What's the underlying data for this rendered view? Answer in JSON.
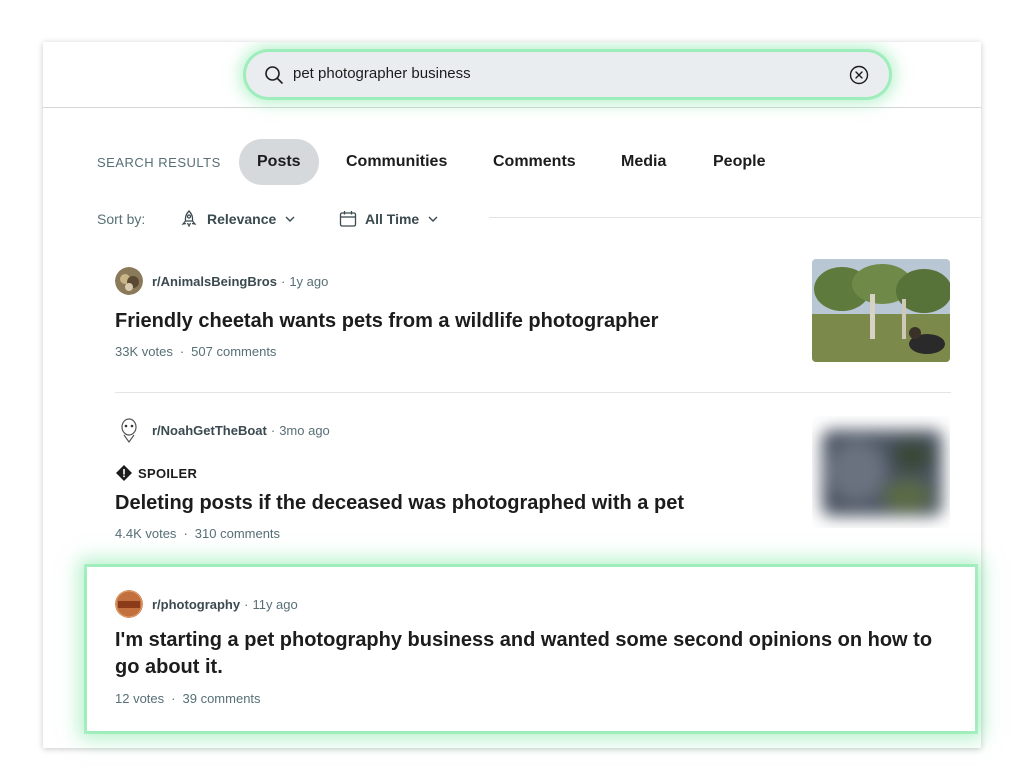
{
  "search": {
    "query": "pet photographer business"
  },
  "tabs": {
    "label": "SEARCH RESULTS",
    "items": [
      "Posts",
      "Communities",
      "Comments",
      "Media",
      "People"
    ]
  },
  "sort": {
    "label": "Sort by:",
    "relevance": "Relevance",
    "time": "All Time"
  },
  "posts": [
    {
      "subreddit": "r/AnimalsBeingBros",
      "age": "1y ago",
      "title": "Friendly cheetah wants pets from a wildlife photographer",
      "votes": "33K votes",
      "comments": "507 comments"
    },
    {
      "subreddit": "r/NoahGetTheBoat",
      "age": "3mo ago",
      "spoiler": "SPOILER",
      "title": "Deleting posts if the deceased was photographed with a pet",
      "votes": "4.4K votes",
      "comments": "310 comments"
    },
    {
      "subreddit": "r/photography",
      "age": "11y ago",
      "title_line1": "I'm starting a pet photography business and wanted some second opinions on how to",
      "title_line2": "go about it.",
      "votes": "12 votes",
      "comments": "39 comments"
    }
  ],
  "colors": {
    "accent_glow": "#78e6a0",
    "tab_active": "#d5d9dc",
    "meta": "#576f76"
  }
}
